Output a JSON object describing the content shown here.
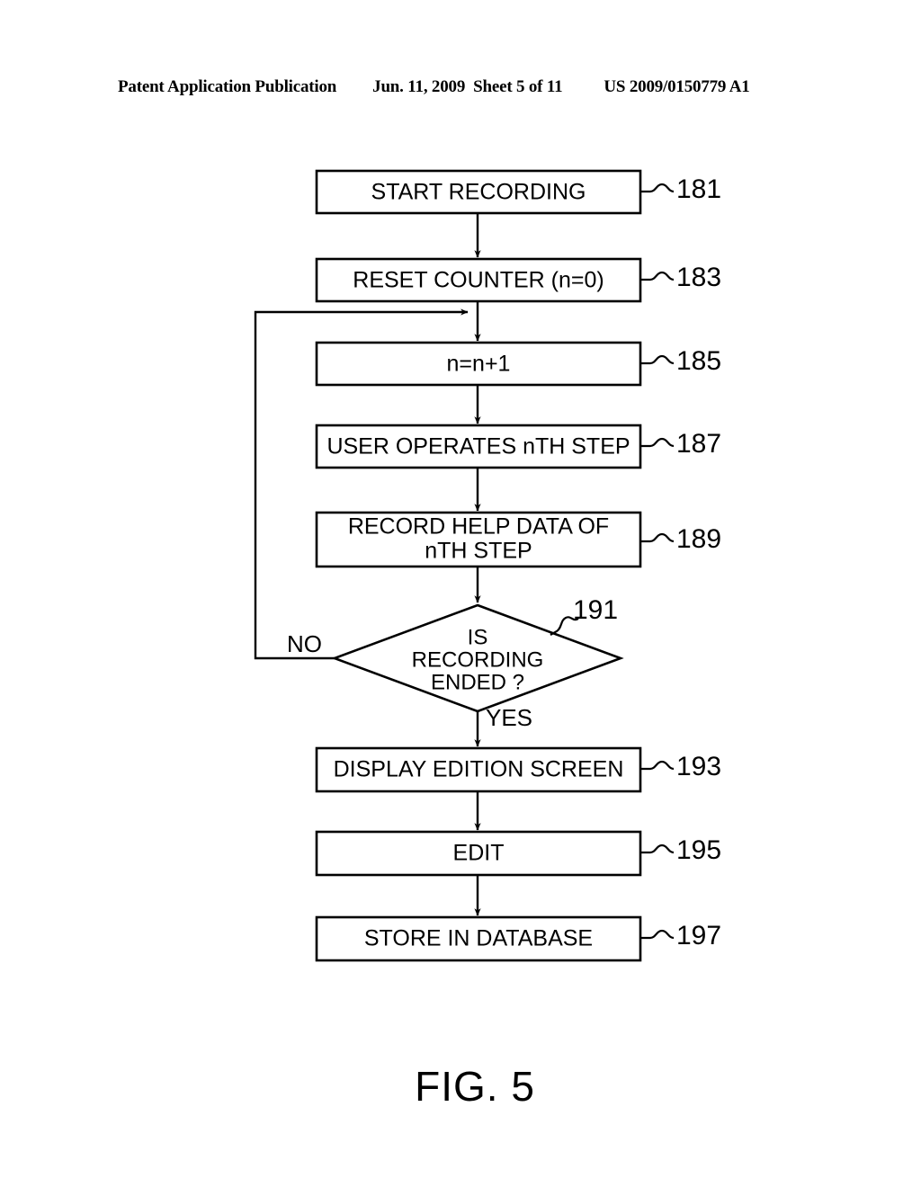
{
  "header": {
    "publication": "Patent Application Publication",
    "date": "Jun. 11, 2009",
    "sheet": "Sheet 5 of 11",
    "doc_number": "US 2009/0150779 A1"
  },
  "figure": {
    "caption": "FIG. 5",
    "colors": {
      "ink": "#000000",
      "paper": "#ffffff"
    },
    "nodes": [
      {
        "id": "n181",
        "shape": "process",
        "ref": "181",
        "lines": [
          "START RECORDING"
        ]
      },
      {
        "id": "n183",
        "shape": "process",
        "ref": "183",
        "lines": [
          "RESET COUNTER (n=0)"
        ]
      },
      {
        "id": "n185",
        "shape": "process",
        "ref": "185",
        "lines": [
          "n=n+1"
        ]
      },
      {
        "id": "n187",
        "shape": "process",
        "ref": "187",
        "lines": [
          "USER OPERATES nTH STEP"
        ]
      },
      {
        "id": "n189",
        "shape": "process",
        "ref": "189",
        "lines": [
          "RECORD HELP DATA OF",
          "nTH STEP"
        ]
      },
      {
        "id": "n191",
        "shape": "decision",
        "ref": "191",
        "lines": [
          "IS",
          "RECORDING",
          "ENDED ?"
        ]
      },
      {
        "id": "n193",
        "shape": "process",
        "ref": "193",
        "lines": [
          "DISPLAY EDITION SCREEN"
        ]
      },
      {
        "id": "n195",
        "shape": "process",
        "ref": "195",
        "lines": [
          "EDIT"
        ]
      },
      {
        "id": "n197",
        "shape": "process",
        "ref": "197",
        "lines": [
          "STORE IN DATABASE"
        ]
      }
    ],
    "branches": {
      "no_label": "NO",
      "yes_label": "YES"
    }
  }
}
